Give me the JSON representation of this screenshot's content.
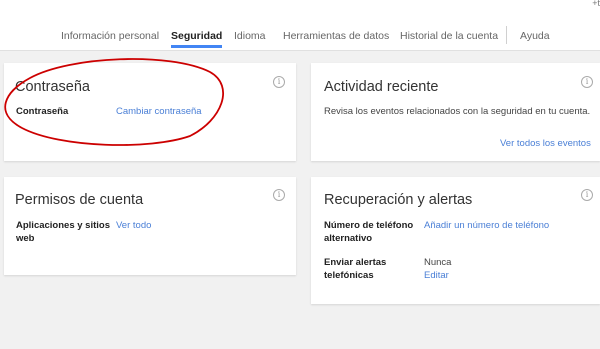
{
  "corner_text": "+t",
  "nav": {
    "tabs": [
      {
        "label": "Información personal"
      },
      {
        "label": "Seguridad"
      },
      {
        "label": "Idioma"
      },
      {
        "label": "Herramientas de datos"
      },
      {
        "label": "Historial de la cuenta"
      },
      {
        "label": "Ayuda"
      }
    ],
    "active_index": 1
  },
  "cards": {
    "password": {
      "title": "Contraseña",
      "info_icon": "info-icon",
      "row_label": "Contraseña",
      "link": "Cambiar contraseña"
    },
    "recent_activity": {
      "title": "Actividad reciente",
      "info_icon": "info-icon",
      "description": "Revisa los eventos relacionados con la seguridad en tu cuenta.",
      "link": "Ver todos los eventos"
    },
    "account_permissions": {
      "title": "Permisos de cuenta",
      "info_icon": "info-icon",
      "row_label_line1": "Aplicaciones y sitios",
      "row_label_line2": "web",
      "link": "Ver todo"
    },
    "recovery": {
      "title": "Recuperación y alertas",
      "info_icon": "info-icon",
      "phone_label_line1": "Número de teléfono",
      "phone_label_line2": "alternativo",
      "phone_link": "Añadir un número de teléfono",
      "alerts_label_line1": "Enviar alertas",
      "alerts_label_line2": "telefónicas",
      "alerts_value": "Nunca",
      "alerts_link": "Editar"
    }
  },
  "colors": {
    "accent": "#4285f4",
    "link": "#4a7fd6",
    "annotation": "#cc0000",
    "background": "#f1f1f1"
  }
}
